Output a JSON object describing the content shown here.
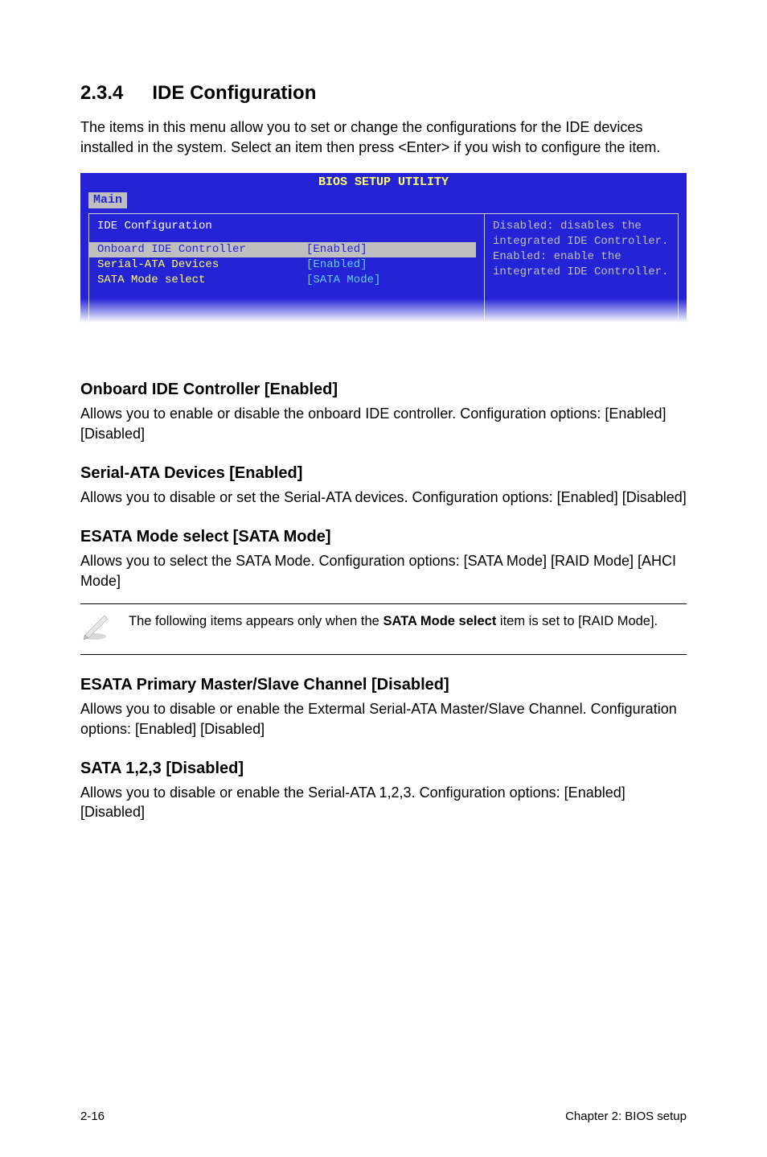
{
  "section": {
    "number": "2.3.4",
    "title": "IDE Configuration"
  },
  "intro": "The items in this menu allow you to set or change the configurations for the IDE devices installed in the system. Select an item then press <Enter> if you wish to configure the item.",
  "bios": {
    "header": "BIOS SETUP UTILITY",
    "tab": "Main",
    "left_title": "IDE Configuration",
    "rows": [
      {
        "label": "Onboard IDE Controller",
        "value": "[Enabled]"
      },
      {
        "label": "Serial-ATA Devices",
        "value": "[Enabled]"
      },
      {
        "label": "SATA Mode select",
        "value": "[SATA Mode]"
      }
    ],
    "help": "Disabled: disables the integrated IDE Controller.\nEnabled: enable the integrated IDE Controller."
  },
  "items": [
    {
      "heading": "Onboard IDE Controller [Enabled]",
      "text": "Allows you to enable or disable the onboard IDE controller. Configuration options: [Enabled] [Disabled]"
    },
    {
      "heading": "Serial-ATA Devices [Enabled]",
      "text": "Allows you to disable or set the Serial-ATA devices. Configuration options: [Enabled] [Disabled]"
    },
    {
      "heading": "ESATA Mode select [SATA Mode]",
      "text": "Allows you to select the SATA Mode. Configuration options: [SATA Mode] [RAID Mode] [AHCI Mode]"
    }
  ],
  "note": {
    "pre": "The following items appears only when the ",
    "bold": "SATA Mode select",
    "post": " item is set to [RAID Mode]."
  },
  "items2": [
    {
      "heading": "ESATA Primary Master/Slave Channel [Disabled]",
      "text": "Allows you to disable or enable the Extermal Serial-ATA Master/Slave Channel. Configuration options: [Enabled] [Disabled]"
    },
    {
      "heading": "SATA 1,2,3 [Disabled]",
      "text": "Allows you to disable or enable the Serial-ATA 1,2,3. Configuration options: [Enabled] [Disabled]"
    }
  ],
  "footer": {
    "left": "2-16",
    "right": "Chapter 2: BIOS setup"
  }
}
